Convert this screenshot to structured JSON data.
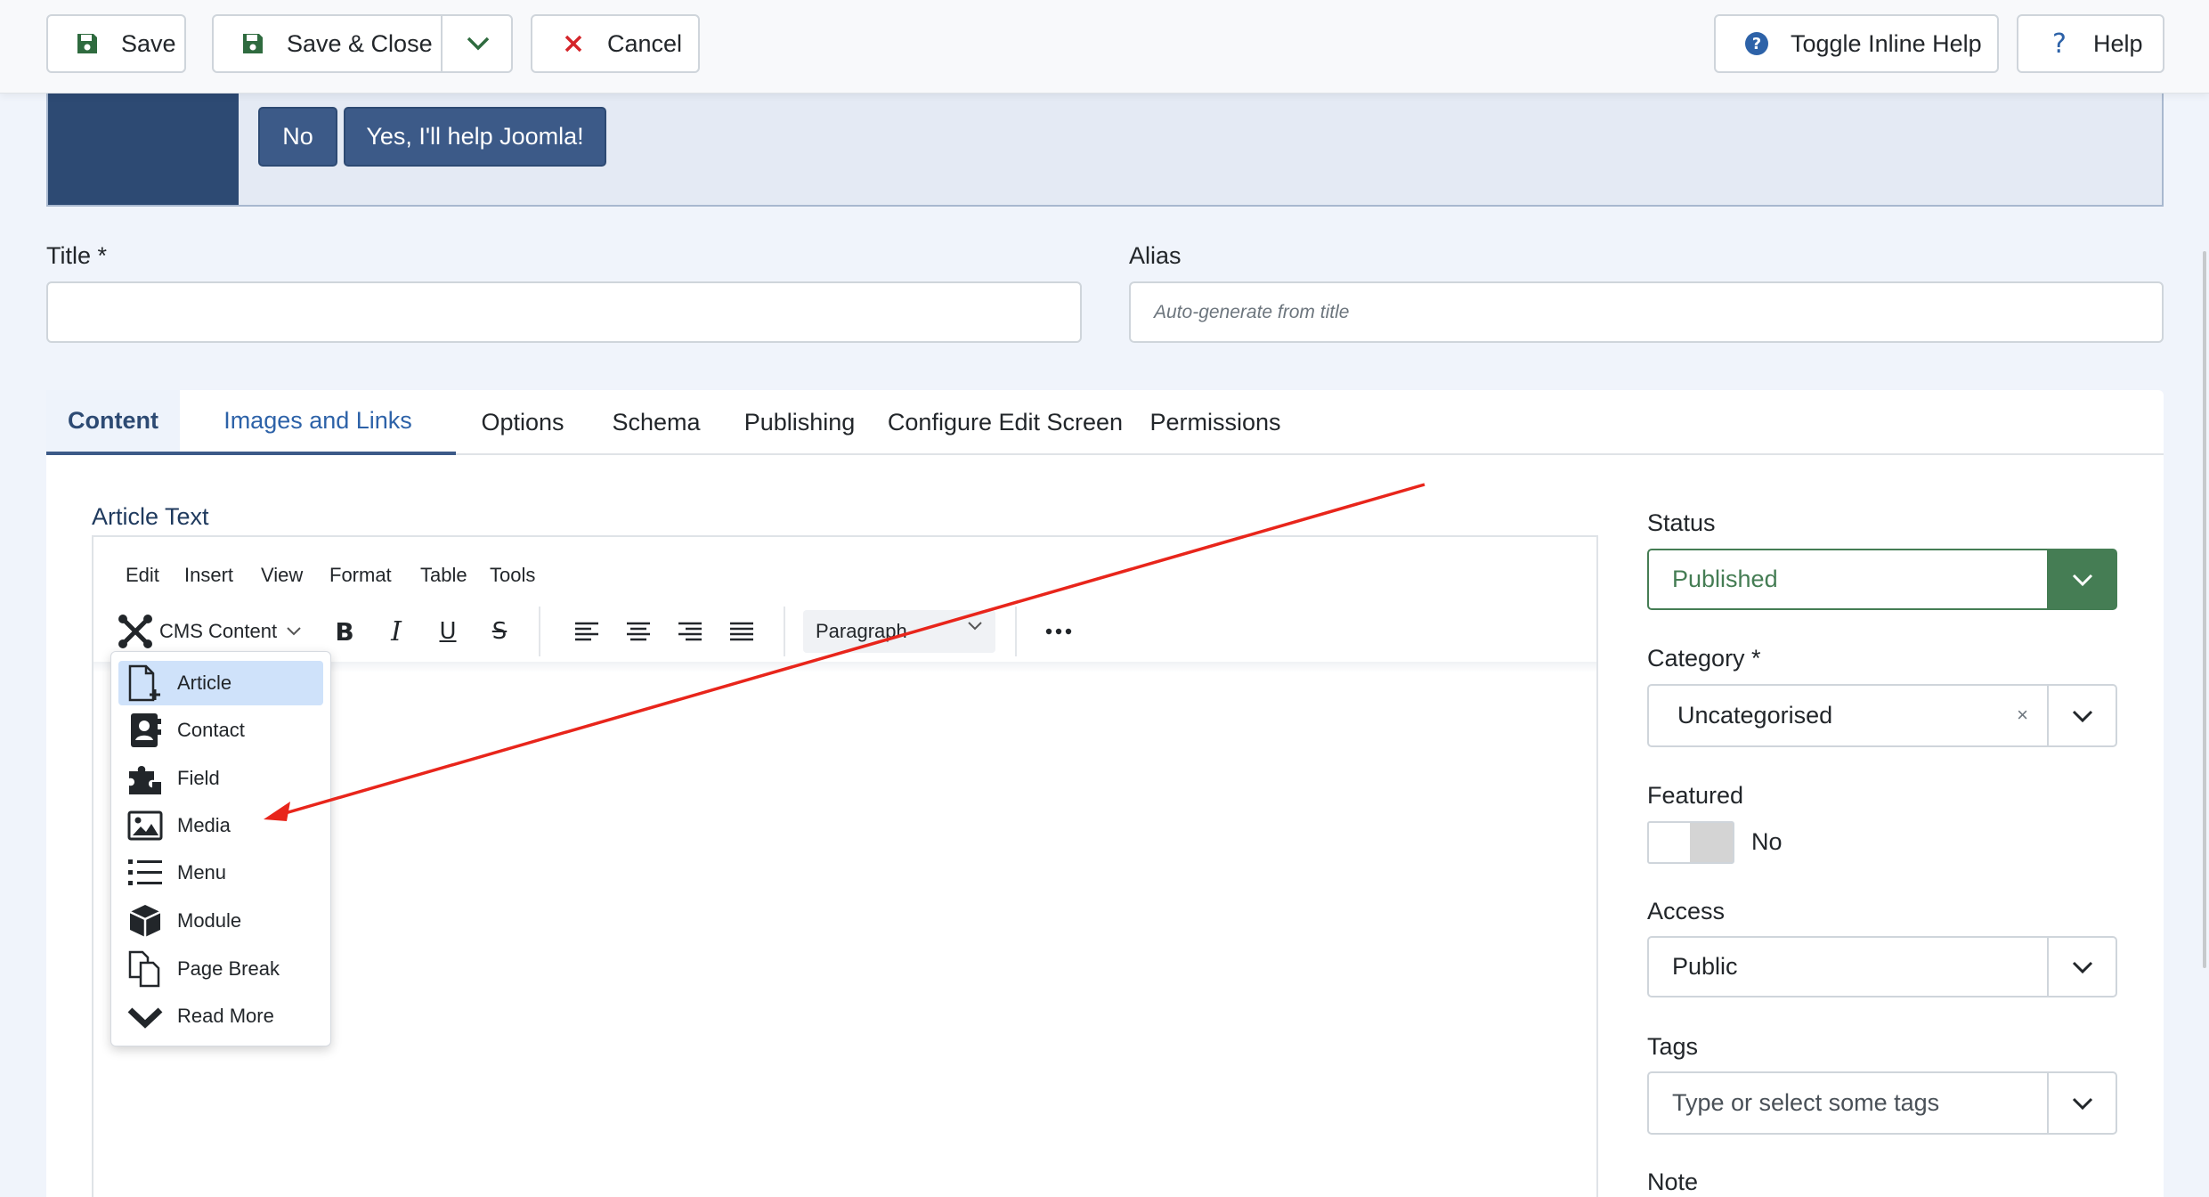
{
  "toolbar": {
    "save_label": "Save",
    "save_close_label": "Save & Close",
    "cancel_label": "Cancel",
    "toggle_help_label": "Toggle Inline Help",
    "help_label": "Help"
  },
  "banner": {
    "no_label": "No",
    "yes_label": "Yes, I'll help Joomla!"
  },
  "form": {
    "title_label": "Title *",
    "title_value": "",
    "alias_label": "Alias",
    "alias_placeholder": "Auto-generate from title"
  },
  "tabs": [
    {
      "label": "Content"
    },
    {
      "label": "Images and Links"
    },
    {
      "label": "Options"
    },
    {
      "label": "Schema"
    },
    {
      "label": "Publishing"
    },
    {
      "label": "Configure Edit Screen"
    },
    {
      "label": "Permissions"
    }
  ],
  "editor": {
    "label": "Article Text",
    "menu": [
      "Edit",
      "Insert",
      "View",
      "Format",
      "Table",
      "Tools"
    ],
    "cms_content_label": "CMS Content",
    "block_format": "Paragraph",
    "cms_menu_items": [
      {
        "label": "Article",
        "icon": "article-icon"
      },
      {
        "label": "Contact",
        "icon": "contact-icon"
      },
      {
        "label": "Field",
        "icon": "field-icon"
      },
      {
        "label": "Media",
        "icon": "media-icon"
      },
      {
        "label": "Menu",
        "icon": "menu-icon"
      },
      {
        "label": "Module",
        "icon": "module-icon"
      },
      {
        "label": "Page Break",
        "icon": "page-break-icon"
      },
      {
        "label": "Read More",
        "icon": "read-more-icon"
      }
    ]
  },
  "sidebar": {
    "status_label": "Status",
    "status_value": "Published",
    "category_label": "Category *",
    "category_value": "Uncategorised",
    "category_clear": "×",
    "featured_label": "Featured",
    "featured_value": "No",
    "access_label": "Access",
    "access_value": "Public",
    "tags_label": "Tags",
    "tags_placeholder": "Type or select some tags",
    "note_label": "Note"
  },
  "colors": {
    "primary_dark": "#2d4a73",
    "button_blue": "#3c5a88",
    "published_green": "#457d54",
    "annotation_red": "#e8251b"
  }
}
